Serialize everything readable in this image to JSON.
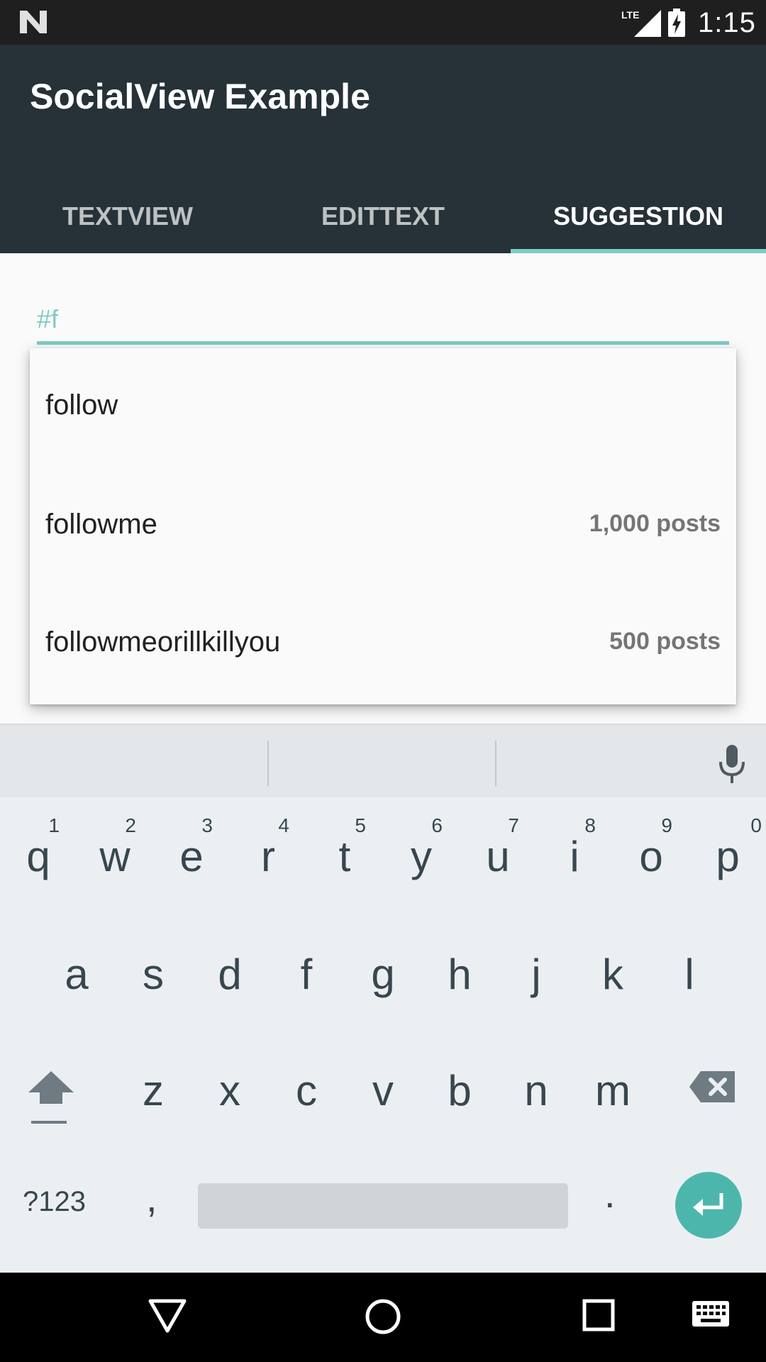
{
  "status_bar": {
    "network": "LTE",
    "time": "1:15"
  },
  "app_bar": {
    "title": "SocialView Example",
    "tabs": [
      {
        "label": "TEXTVIEW",
        "active": false
      },
      {
        "label": "EDITTEXT",
        "active": false
      },
      {
        "label": "SUGGESTION",
        "active": true
      }
    ]
  },
  "input": {
    "value": "#f"
  },
  "suggestions": [
    {
      "name": "follow",
      "count": ""
    },
    {
      "name": "followme",
      "count": "1,000 posts"
    },
    {
      "name": "followmeorillkillyou",
      "count": "500 posts"
    }
  ],
  "keyboard": {
    "row1": [
      {
        "letter": "q",
        "hint": "1"
      },
      {
        "letter": "w",
        "hint": "2"
      },
      {
        "letter": "e",
        "hint": "3"
      },
      {
        "letter": "r",
        "hint": "4"
      },
      {
        "letter": "t",
        "hint": "5"
      },
      {
        "letter": "y",
        "hint": "6"
      },
      {
        "letter": "u",
        "hint": "7"
      },
      {
        "letter": "i",
        "hint": "8"
      },
      {
        "letter": "o",
        "hint": "9"
      },
      {
        "letter": "p",
        "hint": "0"
      }
    ],
    "row2": [
      "a",
      "s",
      "d",
      "f",
      "g",
      "h",
      "j",
      "k",
      "l"
    ],
    "row3": [
      "z",
      "x",
      "c",
      "v",
      "b",
      "n",
      "m"
    ],
    "symbols_label": "?123",
    "comma_label": ",",
    "period_label": "."
  },
  "colors": {
    "accent": "#80cbc4",
    "app_bar": "#263238",
    "enter_button": "#4db6ac"
  },
  "icons": {
    "status": [
      "android-n-logo-icon",
      "lte-signal-icon",
      "battery-charging-icon"
    ],
    "keyboard": [
      "microphone-icon",
      "shift-icon",
      "backspace-icon",
      "enter-icon"
    ],
    "nav": [
      "back-icon",
      "home-icon",
      "recent-apps-icon",
      "keyboard-switch-icon"
    ]
  }
}
